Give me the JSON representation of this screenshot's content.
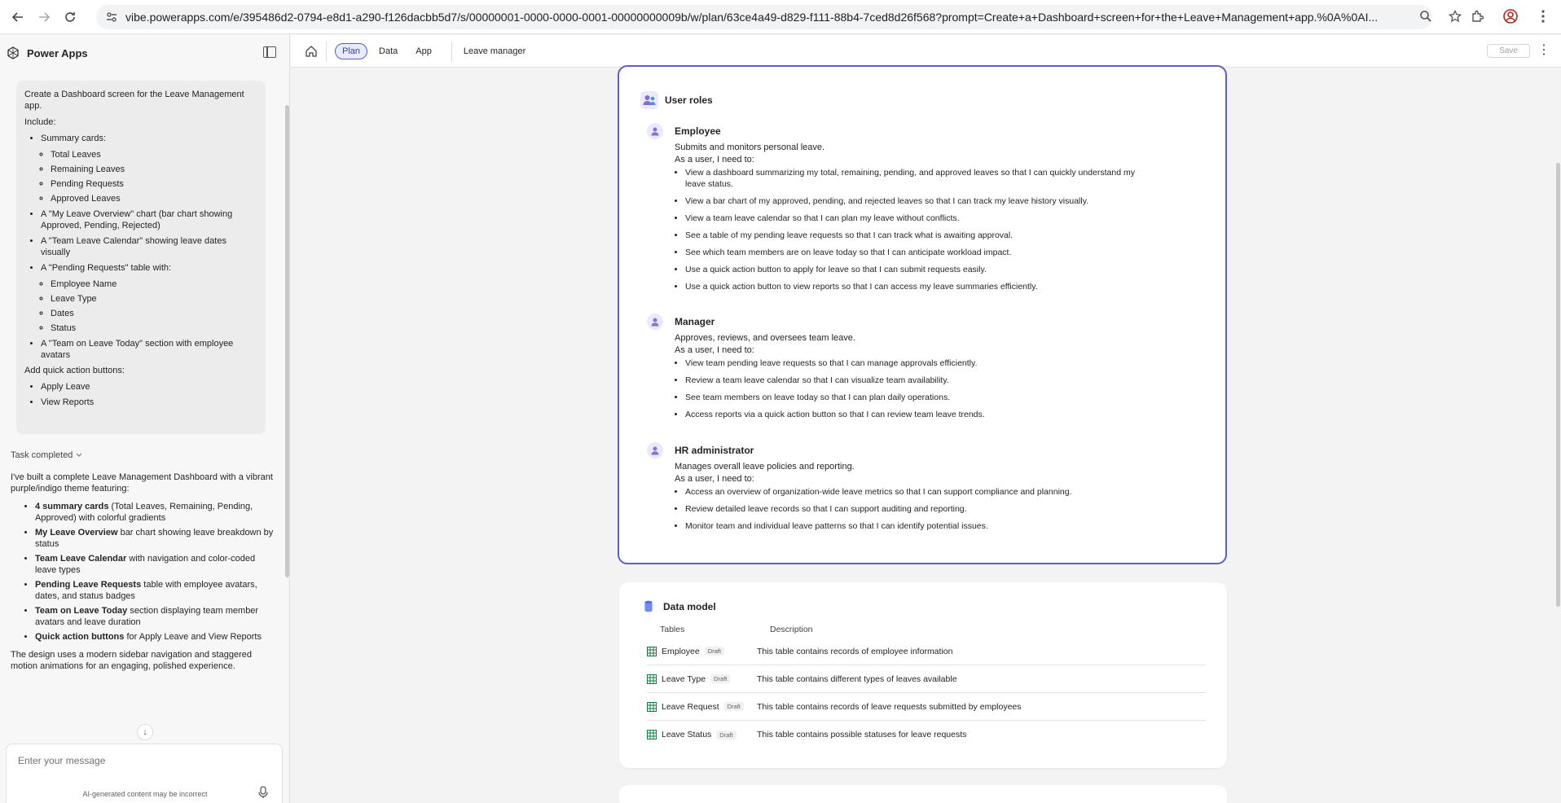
{
  "browser": {
    "url": "vibe.powerapps.com/e/395486d2-0794-e8d1-a290-f126dacbb5d7/s/00000001-0000-0000-0001-00000000009b/w/plan/63ce4a49-d829-f111-88b4-7ced8d26f568?prompt=Create+a+Dashboard+screen+for+the+Leave+Management+app.%0A%0AI..."
  },
  "app": {
    "title": "Power Apps"
  },
  "chat": {
    "prompt_intro": "Create a Dashboard screen for the Leave Management app.",
    "prompt_include": "Include:",
    "summary_cards_label": "Summary cards:",
    "summary_cards": [
      "Total Leaves",
      "Remaining Leaves",
      "Pending Requests",
      "Approved Leaves"
    ],
    "chart_item": "A \"My Leave Overview\" chart (bar chart showing Approved, Pending, Rejected)",
    "calendar_item": "A \"Team Leave Calendar\" showing leave dates visually",
    "table_item": "A \"Pending Requests\" table with:",
    "table_columns": [
      "Employee Name",
      "Leave Type",
      "Dates",
      "Status"
    ],
    "team_item": "A \"Team on Leave Today\" section with employee avatars",
    "quick_actions_label": "Add quick action buttons:",
    "quick_actions": [
      "Apply Leave",
      "View Reports"
    ],
    "task_status": "Task completed",
    "reply_intro": "I've built a complete Leave Management Dashboard with a vibrant purple/indigo theme featuring:",
    "reply_items": [
      {
        "bold": "4 summary cards",
        "text": " (Total Leaves, Remaining, Pending, Approved) with colorful gradients"
      },
      {
        "bold": "My Leave Overview",
        "text": " bar chart showing leave breakdown by status"
      },
      {
        "bold": "Team Leave Calendar",
        "text": " with navigation and color-coded leave types"
      },
      {
        "bold": "Pending Leave Requests",
        "text": " table with employee avatars, dates, and status badges"
      },
      {
        "bold": "Team on Leave Today",
        "text": " section displaying team member avatars and leave duration"
      },
      {
        "bold": "Quick action buttons",
        "text": " for Apply Leave and View Reports"
      }
    ],
    "reply_outro": "The design uses a modern sidebar navigation and staggered motion animations for an engaging, polished experience.",
    "input_placeholder": "Enter your message",
    "disclaimer": "AI-generated content may be incorrect"
  },
  "toolbar": {
    "tabs": [
      "Plan",
      "Data",
      "App"
    ],
    "app_name": "Leave manager",
    "save_label": "Save"
  },
  "user_roles": {
    "title": "User roles",
    "need_label": "As a user, I need to:",
    "roles": [
      {
        "name": "Employee",
        "description": "Submits and monitors personal leave.",
        "needs": [
          "View a dashboard summarizing my total, remaining, pending, and approved leaves so that I can quickly understand my leave status.",
          "View a bar chart of my approved, pending, and rejected leaves so that I can track my leave history visually.",
          "View a team leave calendar so that I can plan my leave without conflicts.",
          "See a table of my pending leave requests so that I can track what is awaiting approval.",
          "See which team members are on leave today so that I can anticipate workload impact.",
          "Use a quick action button to apply for leave so that I can submit requests easily.",
          "Use a quick action button to view reports so that I can access my leave summaries efficiently."
        ]
      },
      {
        "name": "Manager",
        "description": "Approves, reviews, and oversees team leave.",
        "needs": [
          "View team pending leave requests so that I can manage approvals efficiently.",
          "Review a team leave calendar so that I can visualize team availability.",
          "See team members on leave today so that I can plan daily operations.",
          "Access reports via a quick action button so that I can review team leave trends."
        ]
      },
      {
        "name": "HR administrator",
        "description": "Manages overall leave policies and reporting.",
        "needs": [
          "Access an overview of organization-wide leave metrics so that I can support compliance and planning.",
          "Review detailed leave records so that I can support auditing and reporting.",
          "Monitor team and individual leave patterns so that I can identify potential issues."
        ]
      }
    ]
  },
  "data_model": {
    "title": "Data model",
    "col_tables": "Tables",
    "col_description": "Description",
    "draft_label": "Draft",
    "tables": [
      {
        "name": "Employee",
        "description": "This table contains records of employee information"
      },
      {
        "name": "Leave Type",
        "description": "This table contains different types of leaves available"
      },
      {
        "name": "Leave Request",
        "description": "This table contains records of leave requests submitted by employees"
      },
      {
        "name": "Leave Status",
        "description": "This table contains possible statuses for leave requests"
      }
    ]
  }
}
